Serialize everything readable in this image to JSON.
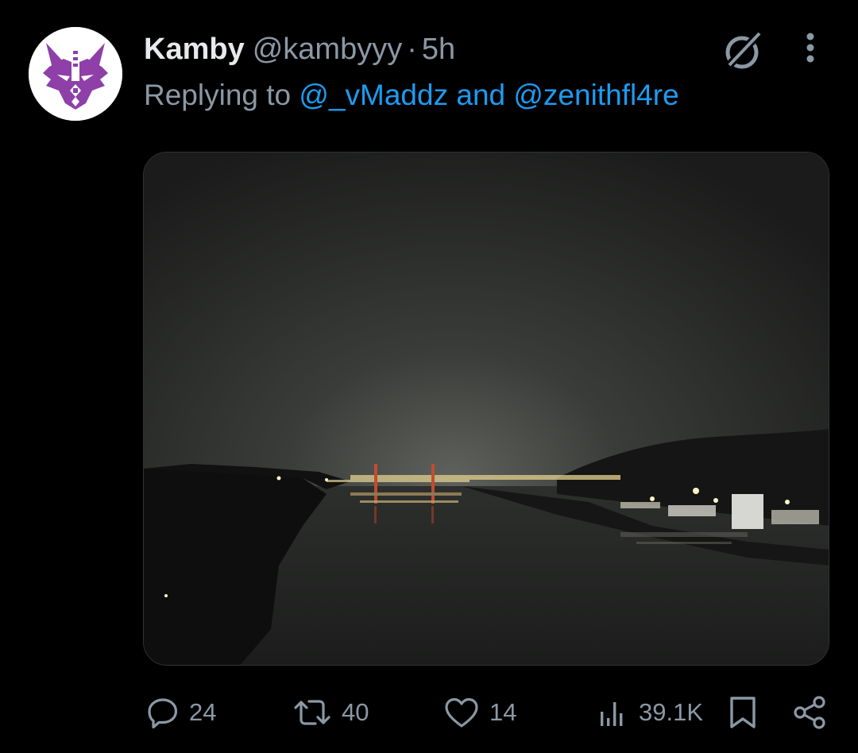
{
  "tweet": {
    "display_name": "Kamby",
    "handle": "@kambyyy",
    "separator": "·",
    "time": "5h",
    "reply_prefix": "Replying to",
    "reply_mentions": "@_vMaddz and @zenithfl4re",
    "avatar_icon": "purple-cat-mask-logo",
    "media_alt": "night-river-cityscape-photo"
  },
  "actions": {
    "reply_count": "24",
    "retweet_count": "40",
    "like_count": "14",
    "views_count": "39.1K"
  },
  "icons": {
    "grok": "grok-icon",
    "more": "more-vertical-icon",
    "reply": "reply-icon",
    "retweet": "retweet-icon",
    "like": "heart-icon",
    "views": "views-chart-icon",
    "bookmark": "bookmark-icon",
    "share": "share-icon"
  },
  "colors": {
    "background": "#000000",
    "text_primary": "#e7e9ea",
    "text_secondary": "#8b98a5",
    "link": "#1d9bf0",
    "avatar_accent": "#8e3fa8"
  }
}
